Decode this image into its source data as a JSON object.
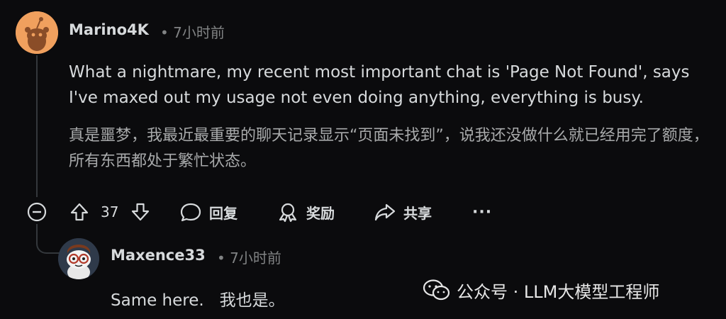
{
  "comment": {
    "username": "Marino4K",
    "time": "7小时前",
    "body_en": "What a nightmare, my recent most important chat is 'Page Not Found', says I've maxed out my usage not even doing anything, everything is busy.",
    "body_zh": "真是噩梦，我最近最重要的聊天记录显示“页面未找到”，说我还没做什么就已经用完了额度，所有东西都处于繁忙状态。",
    "actions": {
      "vote_count": "37",
      "reply_label": "回复",
      "award_label": "奖励",
      "share_label": "共享",
      "more_label": "···"
    }
  },
  "reply": {
    "username": "Maxence33",
    "time": "7小时前",
    "body": "Same here.   我也是。"
  },
  "watermark": {
    "text": "公众号 · LLM大模型工程师"
  },
  "colors": {
    "background": "#0b0b0d",
    "text": "#d7dadc",
    "muted": "#818384",
    "avatar_orange": "#f0a05e"
  },
  "icons": [
    "snoo-avatar-icon",
    "collapse-icon",
    "upvote-icon",
    "downvote-icon",
    "comment-icon",
    "award-icon",
    "share-icon",
    "more-icon",
    "wechat-icon"
  ]
}
